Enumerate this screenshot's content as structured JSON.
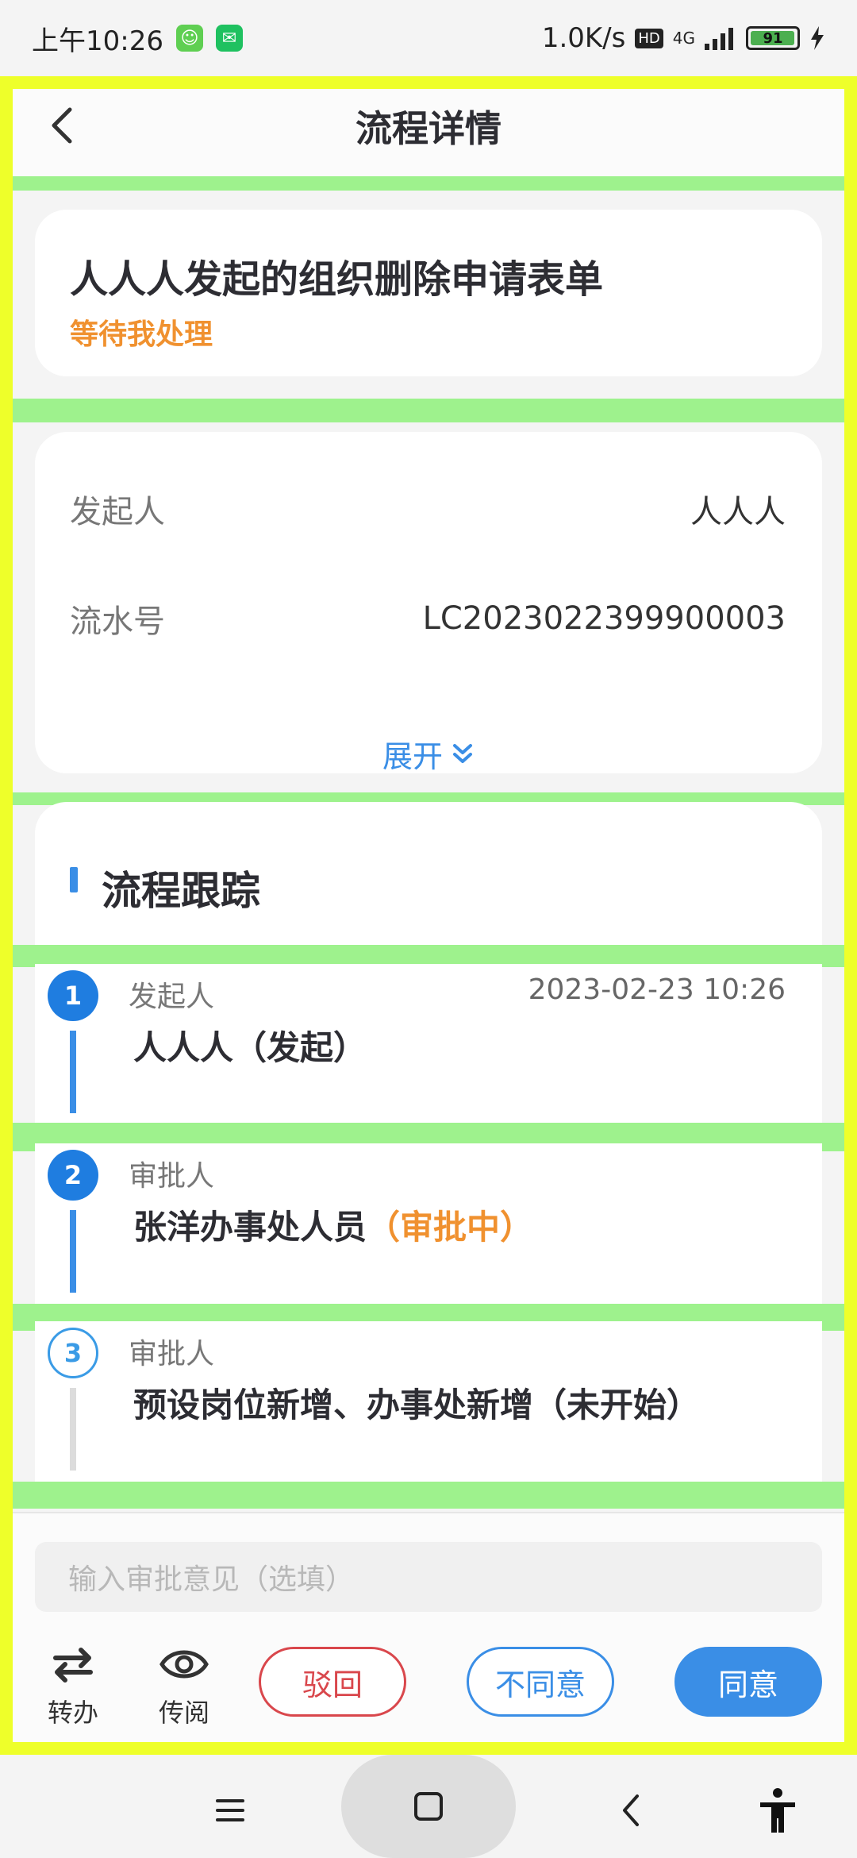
{
  "status_bar": {
    "time": "上午10:26",
    "network_speed": "1.0K/s",
    "hd": "HD",
    "signal": "4G",
    "battery": "91",
    "icons": [
      "app-icon",
      "wechat-icon",
      "signal-icon",
      "battery-icon",
      "charging-icon"
    ]
  },
  "header": {
    "title": "流程详情",
    "back_icon": "chevron-left-icon"
  },
  "summary": {
    "title": "人人人发起的组织删除申请表单",
    "status": "等待我处理"
  },
  "info": {
    "initiator_label": "发起人",
    "initiator_value": "人人人",
    "serial_label": "流水号",
    "serial_value": "LC2023022399900003",
    "expand_label": "展开"
  },
  "tracking": {
    "title": "流程跟踪",
    "steps": [
      {
        "num": "1",
        "role": "发起人",
        "time": "2023-02-23 10:26",
        "name": "人人人（发起）",
        "status": ""
      },
      {
        "num": "2",
        "role": "审批人",
        "time": "",
        "name": "张洋办事处人员",
        "status": "（审批中）"
      },
      {
        "num": "3",
        "role": "审批人",
        "time": "",
        "name": "预设岗位新增、办事处新增（未开始）",
        "status": ""
      }
    ]
  },
  "bottom": {
    "opinion_placeholder": "输入审批意见（选填）",
    "transfer_label": "转办",
    "circulate_label": "传阅",
    "reject_label": "驳回",
    "disagree_label": "不同意",
    "agree_label": "同意"
  },
  "colors": {
    "accent": "#3a8ee6",
    "pending": "#f0912f",
    "reject": "#d9474c",
    "frame": "#eeff2a",
    "band": "#9ef28d"
  }
}
